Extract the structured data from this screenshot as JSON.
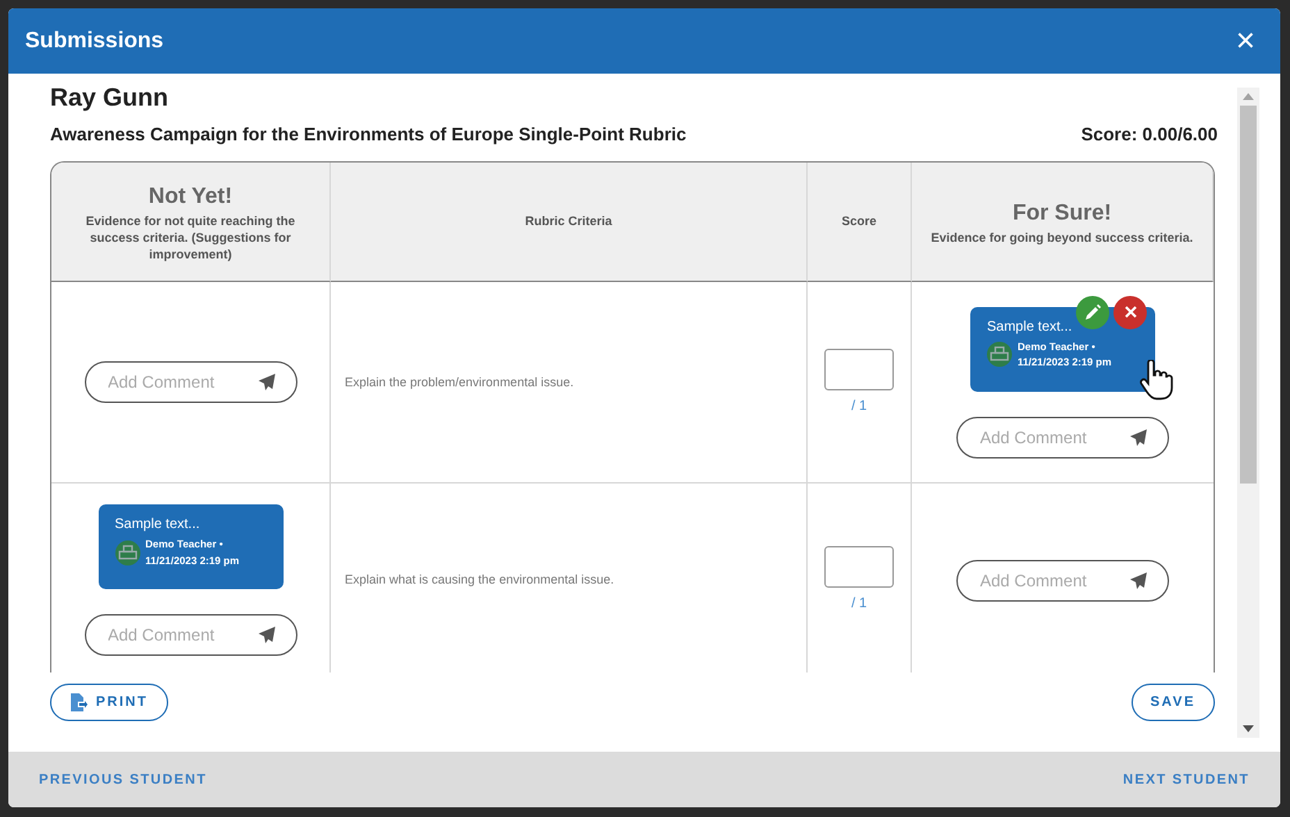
{
  "window": {
    "title": "Submissions",
    "close": "×"
  },
  "student": "Ray Gunn",
  "rubric_title": "Awareness Campaign for the Environments of Europe Single-Point Rubric",
  "score": "Score: 0.00/6.00",
  "columns": [
    {
      "kind": "level",
      "title": "Not Yet!",
      "subtitle": "Evidence for not quite reaching the success criteria. (Suggestions for improvement)"
    },
    {
      "kind": "plain",
      "title": "Rubric Criteria"
    },
    {
      "kind": "plain",
      "title": "Score"
    },
    {
      "kind": "level",
      "title": "For Sure!",
      "subtitle": "Evidence for going beyond success criteria."
    }
  ],
  "rows": [
    {
      "criterion": "Explain the problem/environmental issue.",
      "max": "/ 1",
      "not_yet": {
        "placeholder": "Add Comment"
      },
      "for_sure": {
        "comments": [
          {
            "text": "Sample text...",
            "author": "Demo Teacher •",
            "date": "11/21/2023 2:19 pm",
            "hovered": true
          }
        ],
        "placeholder": "Add Comment"
      }
    },
    {
      "criterion": "Explain what is causing the environmental issue.",
      "max": "/ 1",
      "not_yet": {
        "comments": [
          {
            "text": "Sample text...",
            "author": "Demo Teacher •",
            "date": "11/21/2023 2:19 pm",
            "hovered": false
          }
        ],
        "placeholder": "Add Comment"
      },
      "for_sure": {
        "placeholder": "Add Comment"
      }
    }
  ],
  "buttons": {
    "print": "PRINT",
    "save": "SAVE"
  },
  "footer": {
    "previous": "PREVIOUS STUDENT",
    "next": "NEXT STUDENT"
  }
}
